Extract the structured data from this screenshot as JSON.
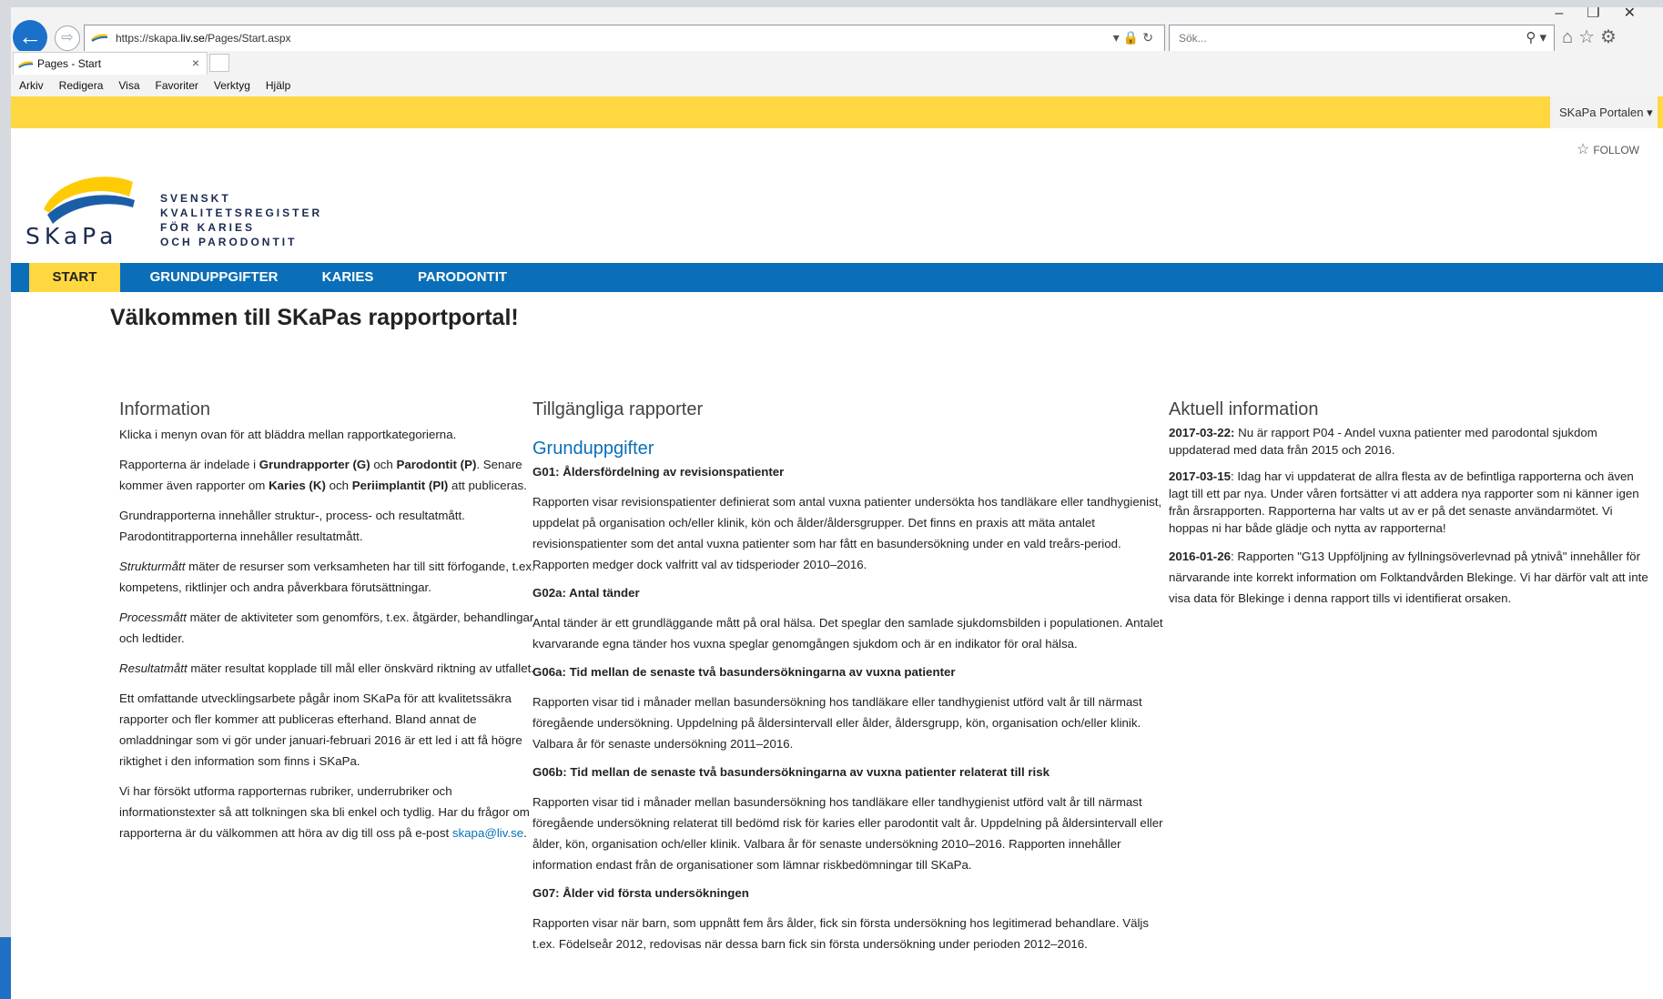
{
  "browser": {
    "url_prefix": "https://skapa.",
    "url_domain": "liv.se",
    "url_path": "/Pages/Start.aspx",
    "search_placeholder": "Sök...",
    "tab_title": "Pages - Start",
    "menu": [
      "Arkiv",
      "Redigera",
      "Visa",
      "Favoriter",
      "Verktyg",
      "Hjälp"
    ]
  },
  "suite": {
    "portal_label": "SKaPa Portalen ▾",
    "follow_label": "FOLLOW"
  },
  "logo": {
    "name": "SKaPa",
    "lines": [
      "SVENSKT",
      "KVALITETSREGISTER",
      "FÖR KARIES",
      "OCH PARODONTIT"
    ]
  },
  "nav": [
    "START",
    "GRUNDUPPGIFTER",
    "KARIES",
    "PARODONTIT"
  ],
  "page_title": "Välkommen till SKaPas rapportportal!",
  "info": {
    "heading": "Information",
    "p1": "Klicka i menyn ovan för att bläddra mellan rapportkategorierna.",
    "p2_a": "Rapporterna är indelade i ",
    "p2_b": "Grundrapporter (G)",
    "p2_c": " och ",
    "p2_d": "Parodontit (P)",
    "p2_e": ". Senare kommer även rapporter om ",
    "p2_f": "Karies (K)",
    "p2_g": " och ",
    "p2_h": "Periimplantit (PI)",
    "p2_i": " att publiceras.",
    "p3": "Grundrapporterna innehåller struktur-, process- och resultatmått. Parodontitrapporterna innehåller resultatmått.",
    "p4_em": "Strukturmått",
    "p4": " mäter de resurser som verksamheten har till sitt förfogande, t.ex. kompetens, riktlinjer och andra påverkbara förutsättningar.",
    "p5_em": "Processmått",
    "p5": " mäter de aktiviteter som genomförs, t.ex. åtgärder, behandlingar och ledtider.",
    "p6_em": "Resultatmått",
    "p6": " mäter resultat kopplade till mål eller önskvärd riktning av utfallet.",
    "p7": "Ett omfattande utvecklingsarbete pågår inom SKaPa för att kvalitetssäkra rapporter och fler kommer att publiceras efterhand. Bland annat de omladdningar som vi gör under januari-februari 2016 är ett led i att få högre riktighet i den information som finns i SKaPa.",
    "p8": "Vi har försökt utforma rapporternas rubriker, underrubriker och informationstexter så att tolkningen ska bli enkel och tydlig. Har du frågor om rapporterna är du välkommen att höra av dig till oss på e-post ",
    "email": "skapa@liv.se",
    "p8_end": "."
  },
  "reports": {
    "heading": "Tillgängliga rapporter",
    "subheading": "Grunduppgifter",
    "items": [
      {
        "title": "G01: Åldersfördelning av revisionspatienter",
        "text": "Rapporten visar revisionspatienter definierat som antal vuxna patienter undersökta hos tandläkare eller tandhygienist, uppdelat på organisation och/eller klinik, kön och ålder/åldersgrupper. Det finns en praxis att mäta antalet revisionspatienter som det antal vuxna patienter som har fått en basundersökning under en vald treårs-period. Rapporten medger dock valfritt val av tidsperioder 2010–2016."
      },
      {
        "title": "G02a: Antal tänder",
        "text": "Antal tänder är ett grundläggande mått på oral hälsa. Det speglar den samlade sjukdomsbilden i populationen. Antalet kvarvarande egna tänder hos vuxna speglar genomgången sjukdom och är en indikator för oral hälsa."
      },
      {
        "title": "G06a: Tid mellan de senaste två basundersökningarna av vuxna patienter",
        "text": "Rapporten visar tid i månader mellan basundersökning hos tandläkare eller tandhygienist utförd valt år till närmast föregående undersökning.  Uppdelning på åldersintervall eller ålder, åldersgrupp, kön, organisation och/eller klinik. Valbara år för senaste undersökning 2011–2016."
      },
      {
        "title": "G06b: Tid mellan de senaste två basundersökningarna av vuxna patienter relaterat till risk",
        "text": "Rapporten visar tid i månader mellan basundersökning hos tandläkare eller tandhygienist utförd valt år till närmast föregående undersökning relaterat till bedömd risk för karies eller parodontit valt år.  Uppdelning på åldersintervall eller ålder, kön, organisation och/eller klinik. Valbara år för senaste undersökning 2010–2016. Rapporten innehåller information endast från de organisationer som lämnar riskbedömningar till SKaPa."
      },
      {
        "title": "G07: Ålder vid första undersökningen",
        "text": "Rapporten visar när barn, som uppnått fem års ålder, fick sin första undersökning hos legitimerad behandlare. Väljs t.ex. Födelseår 2012, redovisas när dessa barn fick sin första undersökning under perioden 2012–2016."
      }
    ]
  },
  "news": {
    "heading": "Aktuell information",
    "items": [
      {
        "date": "2017-03-22:",
        "text": " Nu är rapport P04 - Andel vuxna patienter med parodontal sjukdom uppdaterad med data från 2015 och 2016."
      },
      {
        "date": "2017-03-15",
        "text": ": Idag har vi uppdaterat de allra flesta av de befintliga rapporterna och även lagt till ett par nya. Under våren fortsätter vi att addera nya rapporter som ni känner igen från årsrapporten. Rapporterna har valts ut av er på det senaste användarmötet. Vi hoppas ni har både glädje och nytta av rapporterna!"
      },
      {
        "date": "2016-01-26",
        "text": ": Rapporten \"G13 Uppföljning av fyllningsöverlevnad på ytnivå\" innehåller för närvarande inte korrekt information om Folktandvården Blekinge. Vi har därför valt att inte visa data för Blekinge i denna rapport tills vi identifierat orsaken."
      }
    ]
  },
  "colors": {
    "accent_yellow": "#ffd740",
    "nav_blue": "#0a6fb8",
    "link_blue": "#0a6fb8"
  }
}
